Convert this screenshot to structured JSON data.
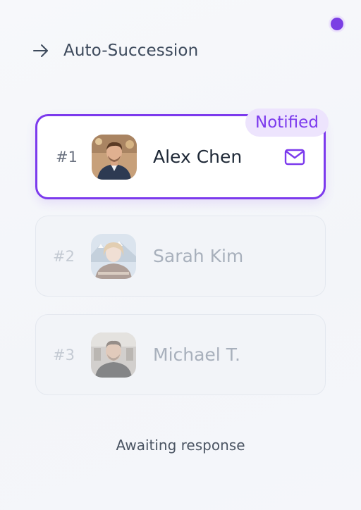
{
  "header": {
    "title": "Auto-Succession",
    "icon": "arrow-right-icon"
  },
  "status_indicator": {
    "color": "#7b3fe4"
  },
  "successors": [
    {
      "rank": "#1",
      "name": "Alex Chen",
      "state": "active",
      "badge": "Notified",
      "action_icon": "mail-icon"
    },
    {
      "rank": "#2",
      "name": "Sarah Kim",
      "state": "pending"
    },
    {
      "rank": "#3",
      "name": "Michael T.",
      "state": "pending"
    }
  ],
  "footer": {
    "status_text": "Awaiting response"
  },
  "colors": {
    "accent": "#7c3aed",
    "badge_bg": "#ede4fd",
    "text_primary": "#1f2937",
    "text_muted": "#a8b0bc"
  }
}
